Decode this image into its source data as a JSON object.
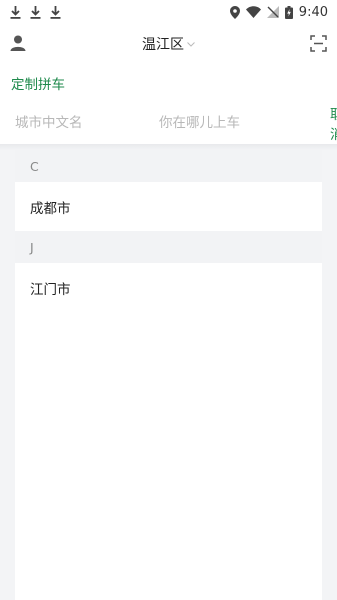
{
  "status_bar": {
    "time": "9:40"
  },
  "header": {
    "district": "温江区"
  },
  "custom_carpool": {
    "label": "定制拼车"
  },
  "search": {
    "city_placeholder": "城市中文名",
    "pickup_placeholder": "你在哪儿上车",
    "cancel_label": "取消"
  },
  "groups": [
    {
      "letter": "C",
      "cities": [
        "成都市"
      ]
    },
    {
      "letter": "J",
      "cities": [
        "江门市"
      ]
    }
  ],
  "colors": {
    "accent": "#1f8a4c",
    "list_bg": "#f3f4f6"
  }
}
